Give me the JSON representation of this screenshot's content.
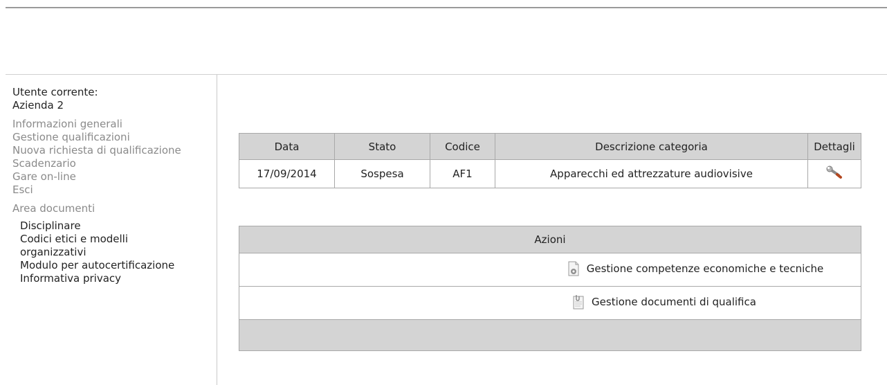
{
  "user": {
    "label": "Utente corrente:",
    "name": "Azienda 2"
  },
  "nav": [
    "Informazioni generali",
    "Gestione qualificazioni",
    "Nuova richiesta di qualificazione",
    "Scadenzario",
    "Gare on-line",
    "Esci"
  ],
  "documents": {
    "title": "Area documenti",
    "items": [
      "Disciplinare",
      "Codici etici e modelli organizzativi",
      "Modulo per autocertificazione",
      "Informativa privacy"
    ]
  },
  "qualifications": {
    "headers": [
      "Data",
      "Stato",
      "Codice",
      "Descrizione categoria",
      "Dettagli"
    ],
    "rows": [
      {
        "data": "17/09/2014",
        "stato": "Sospesa",
        "codice": "AF1",
        "descrizione": "Apparecchi ed attrezzature audiovisive",
        "dettagli_icon": "wrench-icon"
      }
    ]
  },
  "actions": {
    "header": "Azioni",
    "items": [
      {
        "label": "Gestione competenze economiche e tecniche",
        "icon": "document-gear-icon"
      },
      {
        "label": "Gestione documenti di qualifica",
        "icon": "document-clip-icon"
      }
    ]
  }
}
